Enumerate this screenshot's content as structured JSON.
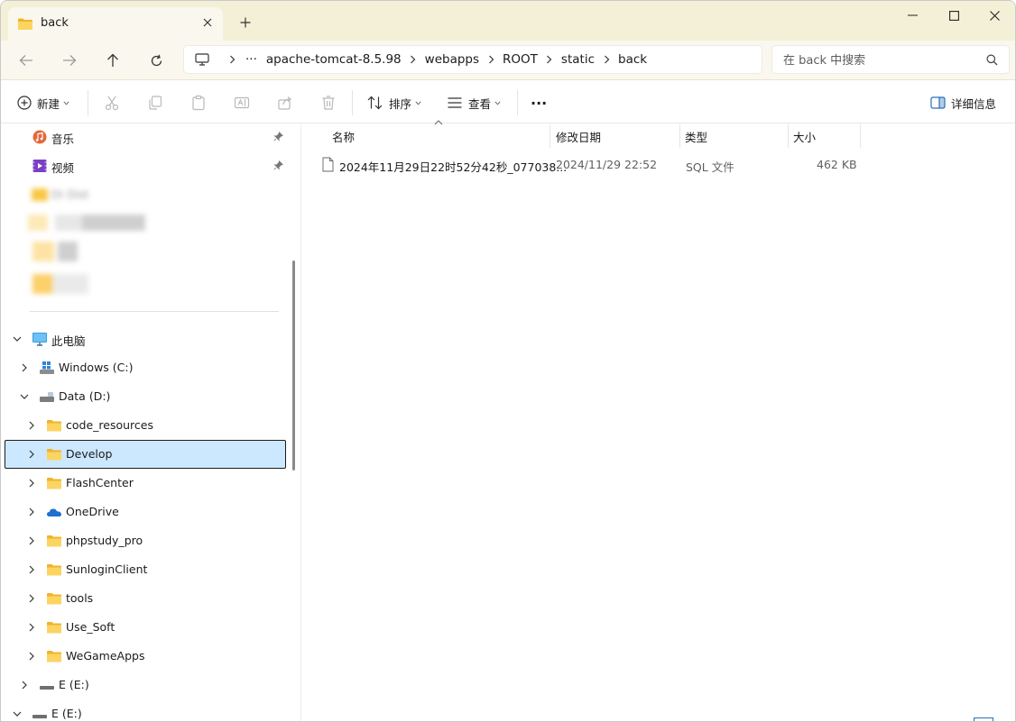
{
  "window": {
    "tab_title": "back",
    "new_tab_symbol": "+"
  },
  "colors": {
    "titlebar_bg": "#f3f0d7",
    "selected_bg": "#cce8ff",
    "folder_yellow": "#f8c744",
    "accent": "#2a6fb5"
  },
  "address": {
    "overflow": "···",
    "crumbs": [
      "apache-tomcat-8.5.98",
      "webapps",
      "ROOT",
      "static",
      "back"
    ]
  },
  "search": {
    "placeholder": "在 back 中搜索"
  },
  "toolbar": {
    "new_label": "新建",
    "sort_label": "排序",
    "view_label": "查看",
    "more_label": "···",
    "details_label": "详细信息",
    "disabled_icons": [
      "cut-icon",
      "copy-icon",
      "paste-icon",
      "rename-icon",
      "share-icon",
      "delete-icon"
    ]
  },
  "sidebar": {
    "quick_access": [
      {
        "label": "音乐",
        "icon": "music-icon",
        "pinned": true
      },
      {
        "label": "视频",
        "icon": "video-icon",
        "pinned": true
      }
    ],
    "blurred_label": "Di Dist",
    "this_pc": "此电脑",
    "drives": {
      "c": "Windows (C:)",
      "d": "Data (D:)"
    },
    "d_children": [
      {
        "label": "code_resources",
        "icon": "folder-icon"
      },
      {
        "label": "Develop",
        "icon": "folder-icon",
        "selected": true
      },
      {
        "label": "FlashCenter",
        "icon": "folder-icon"
      },
      {
        "label": "OneDrive",
        "icon": "onedrive-icon"
      },
      {
        "label": "phpstudy_pro",
        "icon": "folder-icon"
      },
      {
        "label": "SunloginClient",
        "icon": "folder-icon"
      },
      {
        "label": "tools",
        "icon": "folder-icon"
      },
      {
        "label": "Use_Soft",
        "icon": "folder-icon"
      },
      {
        "label": "WeGameApps",
        "icon": "folder-icon"
      }
    ],
    "drive_e1": "E (E:)",
    "drive_e2": "E (E:)"
  },
  "columns": {
    "name": "名称",
    "modified": "修改日期",
    "type": "类型",
    "size": "大小"
  },
  "files": [
    {
      "name": "2024年11月29日22时52分42秒_077038...",
      "modified": "2024/11/29 22:52",
      "type": "SQL 文件",
      "size": "462 KB"
    }
  ]
}
